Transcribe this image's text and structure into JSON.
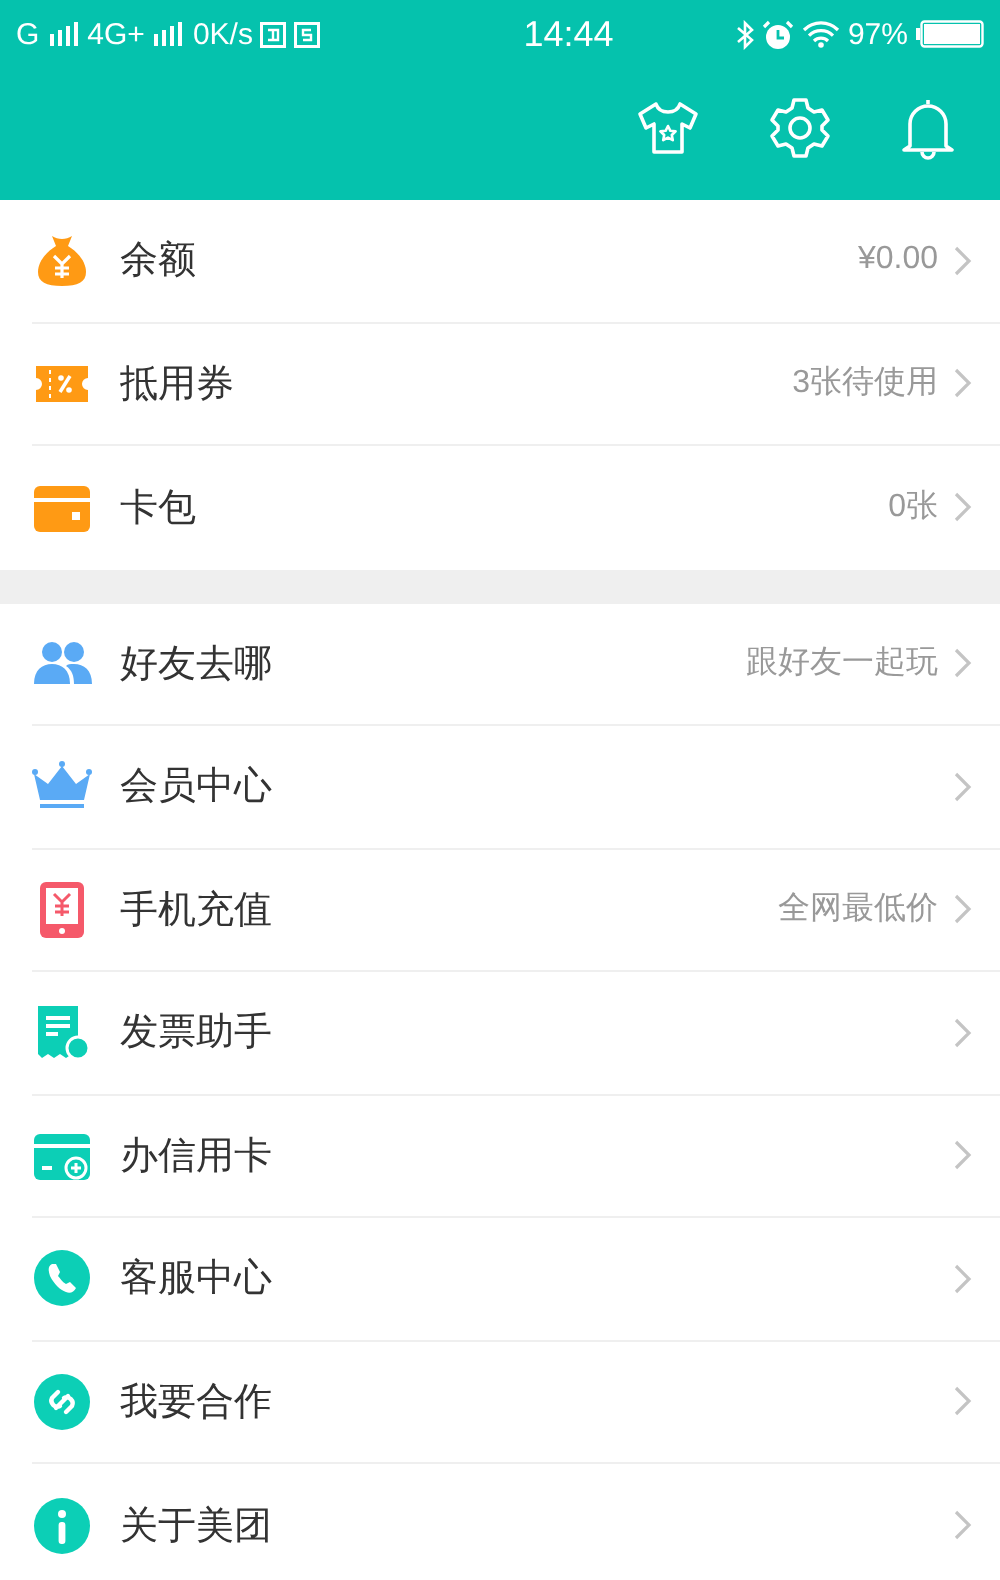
{
  "status_bar": {
    "carrier_1": "G",
    "carrier_2": "4G+",
    "speed": "0K/s",
    "time": "14:44",
    "battery": "97%"
  },
  "sections": [
    {
      "items": [
        {
          "label": "余额",
          "value": "¥0.00"
        },
        {
          "label": "抵用券",
          "value": "3张待使用"
        },
        {
          "label": "卡包",
          "value": "0张"
        }
      ]
    },
    {
      "items": [
        {
          "label": "好友去哪",
          "value": "跟好友一起玩"
        },
        {
          "label": "会员中心"
        },
        {
          "label": "手机充值",
          "value": "全网最低价"
        },
        {
          "label": "发票助手"
        },
        {
          "label": "办信用卡"
        },
        {
          "label": "客服中心"
        },
        {
          "label": "我要合作"
        },
        {
          "label": "关于美团"
        }
      ]
    }
  ]
}
